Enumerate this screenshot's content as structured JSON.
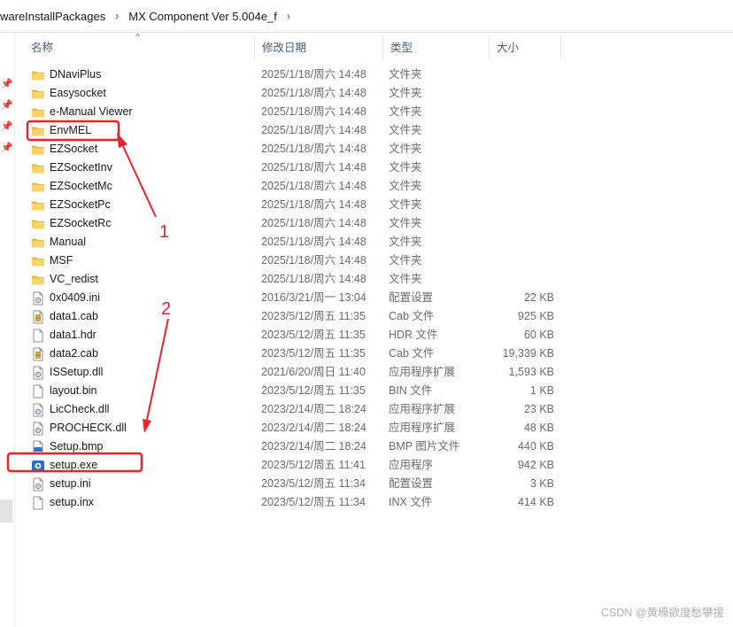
{
  "breadcrumb": [
    "wareInstallPackages",
    "MX Component Ver 5.004e_f"
  ],
  "breadcrumb_separator": "›",
  "columns": {
    "name": "名称",
    "date": "修改日期",
    "type": "类型",
    "size": "大小"
  },
  "files": [
    {
      "name": "DNaviPlus",
      "date": "2025/1/18/周六 14:48",
      "type": "文件夹",
      "size": "",
      "icon": "folder-icon"
    },
    {
      "name": "Easysocket",
      "date": "2025/1/18/周六 14:48",
      "type": "文件夹",
      "size": "",
      "icon": "folder-icon"
    },
    {
      "name": "e-Manual Viewer",
      "date": "2025/1/18/周六 14:48",
      "type": "文件夹",
      "size": "",
      "icon": "folder-icon"
    },
    {
      "name": "EnvMEL",
      "date": "2025/1/18/周六 14:48",
      "type": "文件夹",
      "size": "",
      "icon": "folder-icon"
    },
    {
      "name": "EZSocket",
      "date": "2025/1/18/周六 14:48",
      "type": "文件夹",
      "size": "",
      "icon": "folder-icon"
    },
    {
      "name": "EZSocketInv",
      "date": "2025/1/18/周六 14:48",
      "type": "文件夹",
      "size": "",
      "icon": "folder-icon"
    },
    {
      "name": "EZSocketMc",
      "date": "2025/1/18/周六 14:48",
      "type": "文件夹",
      "size": "",
      "icon": "folder-icon"
    },
    {
      "name": "EZSocketPc",
      "date": "2025/1/18/周六 14:48",
      "type": "文件夹",
      "size": "",
      "icon": "folder-icon"
    },
    {
      "name": "EZSocketRc",
      "date": "2025/1/18/周六 14:48",
      "type": "文件夹",
      "size": "",
      "icon": "folder-icon"
    },
    {
      "name": "Manual",
      "date": "2025/1/18/周六 14:48",
      "type": "文件夹",
      "size": "",
      "icon": "folder-icon"
    },
    {
      "name": "MSF",
      "date": "2025/1/18/周六 14:48",
      "type": "文件夹",
      "size": "",
      "icon": "folder-icon"
    },
    {
      "name": "VC_redist",
      "date": "2025/1/18/周六 14:48",
      "type": "文件夹",
      "size": "",
      "icon": "folder-icon"
    },
    {
      "name": "0x0409.ini",
      "date": "2016/3/21/周一 13:04",
      "type": "配置设置",
      "size": "22 KB",
      "icon": "ini-file-icon"
    },
    {
      "name": "data1.cab",
      "date": "2023/5/12/周五 11:35",
      "type": "Cab 文件",
      "size": "925 KB",
      "icon": "cab-file-icon"
    },
    {
      "name": "data1.hdr",
      "date": "2023/5/12/周五 11:35",
      "type": "HDR 文件",
      "size": "60 KB",
      "icon": "file-icon"
    },
    {
      "name": "data2.cab",
      "date": "2023/5/12/周五 11:35",
      "type": "Cab 文件",
      "size": "19,339 KB",
      "icon": "cab-file-icon"
    },
    {
      "name": "ISSetup.dll",
      "date": "2021/6/20/周日 11:40",
      "type": "应用程序扩展",
      "size": "1,593 KB",
      "icon": "dll-file-icon"
    },
    {
      "name": "layout.bin",
      "date": "2023/5/12/周五 11:35",
      "type": "BIN 文件",
      "size": "1 KB",
      "icon": "file-icon"
    },
    {
      "name": "LicCheck.dll",
      "date": "2023/2/14/周二 18:24",
      "type": "应用程序扩展",
      "size": "23 KB",
      "icon": "dll-file-icon"
    },
    {
      "name": "PROCHECK.dll",
      "date": "2023/2/14/周二 18:24",
      "type": "应用程序扩展",
      "size": "48 KB",
      "icon": "dll-file-icon"
    },
    {
      "name": "Setup.bmp",
      "date": "2023/2/14/周二 18:24",
      "type": "BMP 图片文件",
      "size": "440 KB",
      "icon": "bmp-file-icon"
    },
    {
      "name": "setup.exe",
      "date": "2023/5/12/周五 11:41",
      "type": "应用程序",
      "size": "942 KB",
      "icon": "setup-exe-icon"
    },
    {
      "name": "setup.ini",
      "date": "2023/5/12/周五 11:34",
      "type": "配置设置",
      "size": "3 KB",
      "icon": "ini-file-icon"
    },
    {
      "name": "setup.inx",
      "date": "2023/5/12/周五 11:34",
      "type": "INX 文件",
      "size": "414 KB",
      "icon": "file-icon"
    }
  ],
  "annotations": {
    "label1": "1",
    "label2": "2",
    "color": "#e8242b"
  },
  "watermark": "CSDN @黄壕欲度愁攀援"
}
